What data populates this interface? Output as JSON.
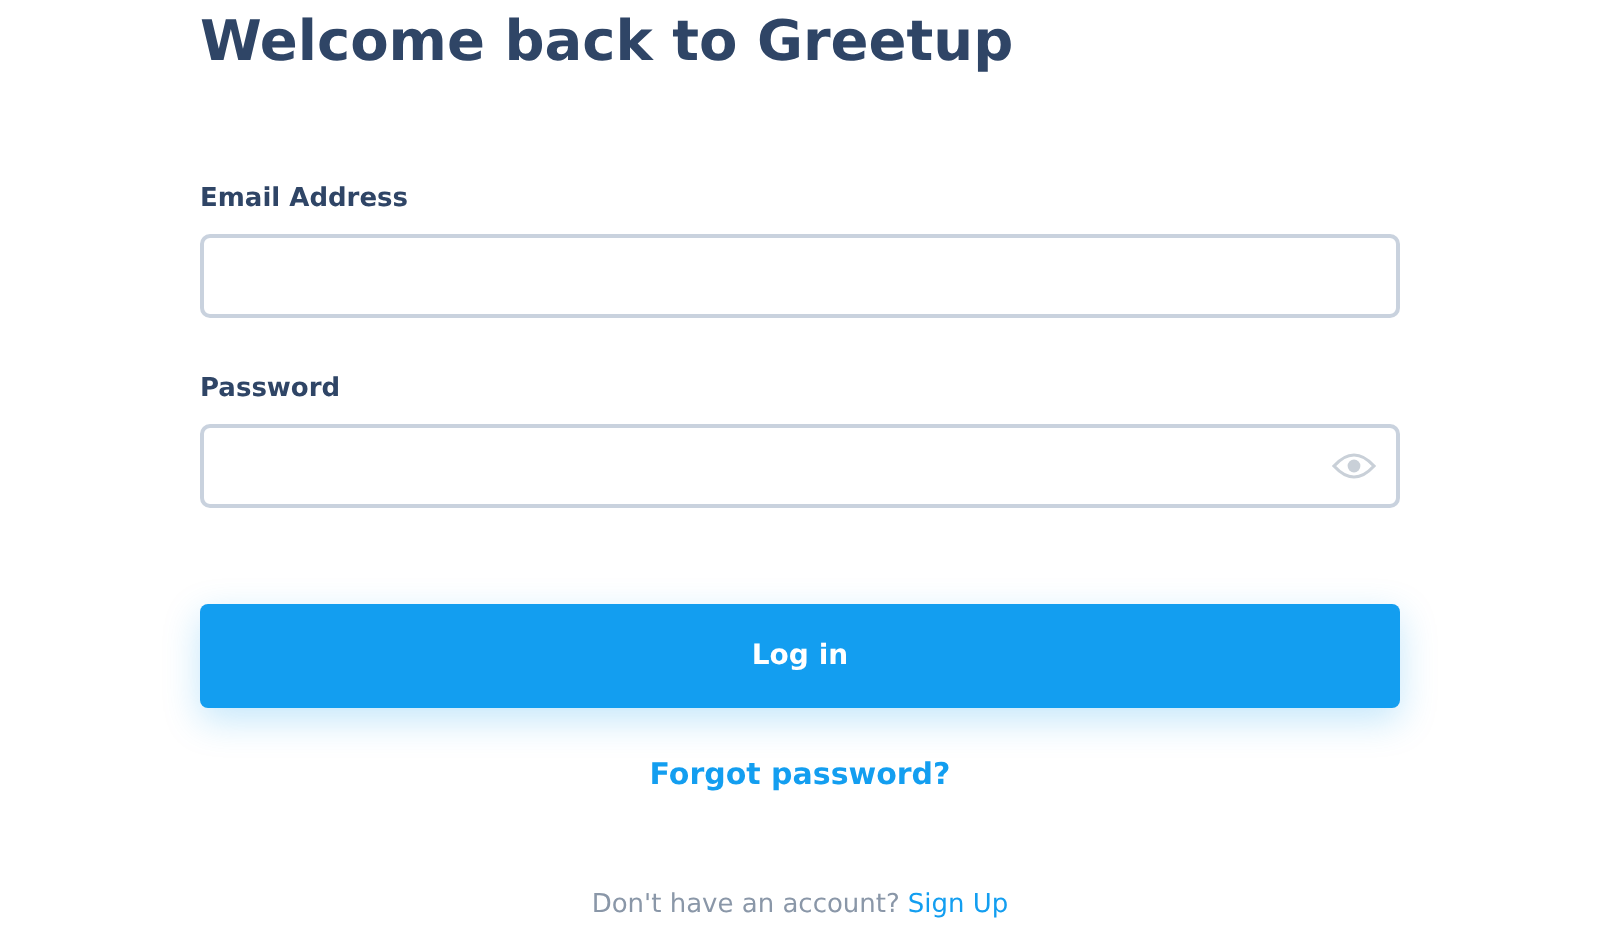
{
  "title": "Welcome back to Greetup",
  "fields": [
    {
      "label": "Email Address",
      "kind": "text"
    },
    {
      "label": "Password",
      "kind": "password"
    }
  ],
  "login_button": "Log in",
  "forgot_link": "Forgot password?",
  "signup": {
    "text": "Don't have an account?",
    "link": "Sign Up"
  }
}
